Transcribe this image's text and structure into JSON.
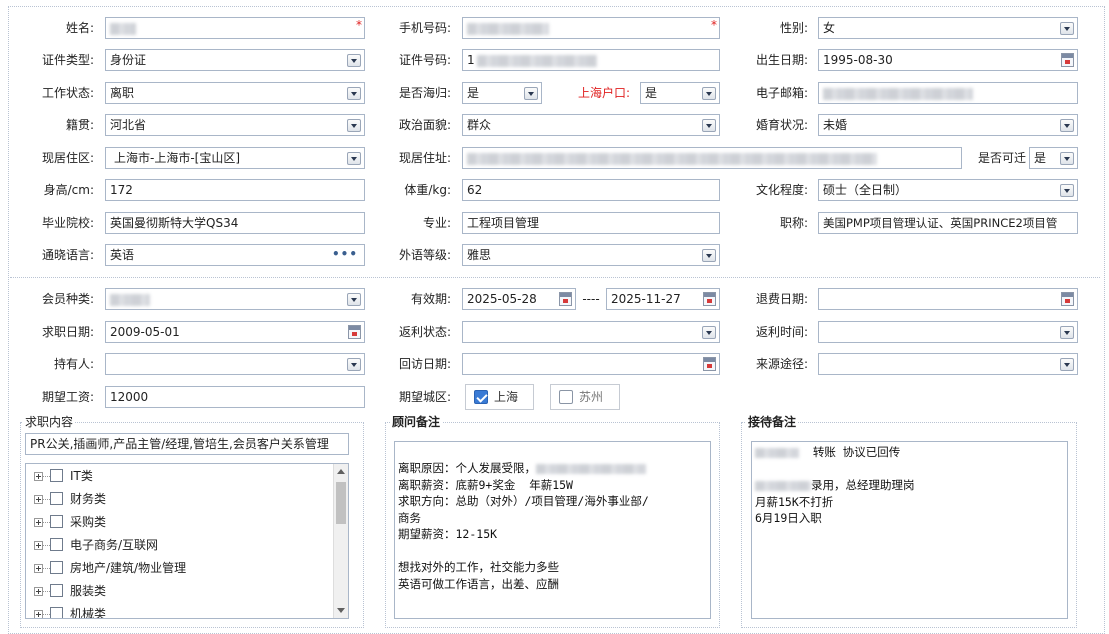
{
  "row1": {
    "name_label": "姓名:",
    "phone_label": "手机号码:",
    "gender_label": "性别:",
    "gender_value": "女"
  },
  "row2": {
    "idtype_label": "证件类型:",
    "idtype_value": "身份证",
    "idno_label": "证件号码:",
    "idno_prefix": "1",
    "birth_label": "出生日期:",
    "birth_value": "1995-08-30"
  },
  "row3": {
    "work_label": "工作状态:",
    "work_value": "离职",
    "overseas_label": "是否海归:",
    "overseas_value": "是",
    "hukou_label": "上海户口:",
    "hukou_value": "是",
    "email_label": "电子邮箱:"
  },
  "row4": {
    "native_label": "籍贯:",
    "native_value": "河北省",
    "politics_label": "政治面貌:",
    "politics_value": "群众",
    "marital_label": "婚育状况:",
    "marital_value": "未婚"
  },
  "row5": {
    "residence_label": "现居住区:",
    "residence_value": "上海市-上海市-[宝山区]",
    "address_label": "现居住址:",
    "relocate_label": "是否可迁",
    "relocate_value": "是"
  },
  "row6": {
    "height_label": "身高/cm:",
    "height_value": "172",
    "weight_label": "体重/kg:",
    "weight_value": "62",
    "edu_label": "文化程度:",
    "edu_value": "硕士（全日制）"
  },
  "row7": {
    "school_label": "毕业院校:",
    "school_value": "英国曼彻斯特大学QS34",
    "major_label": "专业:",
    "major_value": "工程项目管理",
    "title_label": "职称:",
    "title_value": "美国PMP项目管理认证、英国PRINCE2项目管"
  },
  "row8": {
    "lang_label": "通晓语言:",
    "lang_value": "英语",
    "lang_level_label": "外语等级:",
    "lang_level_value": "雅思"
  },
  "row9": {
    "member_label": "会员种类:",
    "valid_label": "有效期:",
    "valid_from": "2025-05-28",
    "valid_sep": "----",
    "valid_to": "2025-11-27",
    "refund_label": "退费日期:"
  },
  "row10": {
    "jobdate_label": "求职日期:",
    "jobdate_value": "2009-05-01",
    "rebate_status_label": "返利状态:",
    "rebate_time_label": "返利时间:"
  },
  "row11": {
    "holder_label": "持有人:",
    "visit_label": "回访日期:",
    "source_label": "来源途径:"
  },
  "row12": {
    "salary_label": "期望工资:",
    "salary_value": "12000",
    "city_label": "期望城区:",
    "city_options": [
      {
        "label": "上海",
        "checked": true
      },
      {
        "label": "苏州",
        "checked": false
      }
    ]
  },
  "job_panel": {
    "title": "求职内容",
    "summary": "PR公关,插画师,产品主管/经理,管培生,会员客户关系管理",
    "tree": [
      "IT类",
      "财务类",
      "采购类",
      "电子商务/互联网",
      "房地产/建筑/物业管理",
      "服装类",
      "机械类"
    ]
  },
  "advisor_panel": {
    "title": "顾问备注",
    "lines": [
      "离职原因：个人发展受限，",
      "离职薪资：底薪9+奖金  年薪15W",
      "求职方向：总助（对外）/项目管理/海外事业部/",
      "商务",
      "期望薪资：12-15K",
      "",
      "想找对外的工作，社交能力多些",
      "英语可做工作语言，出差、应酬"
    ]
  },
  "reception_panel": {
    "title": "接待备注",
    "lines": [
      "  转账 协议已回传",
      "",
      "录用，总经理助理岗",
      "月薪15K不打折",
      "6月19日入职"
    ]
  }
}
